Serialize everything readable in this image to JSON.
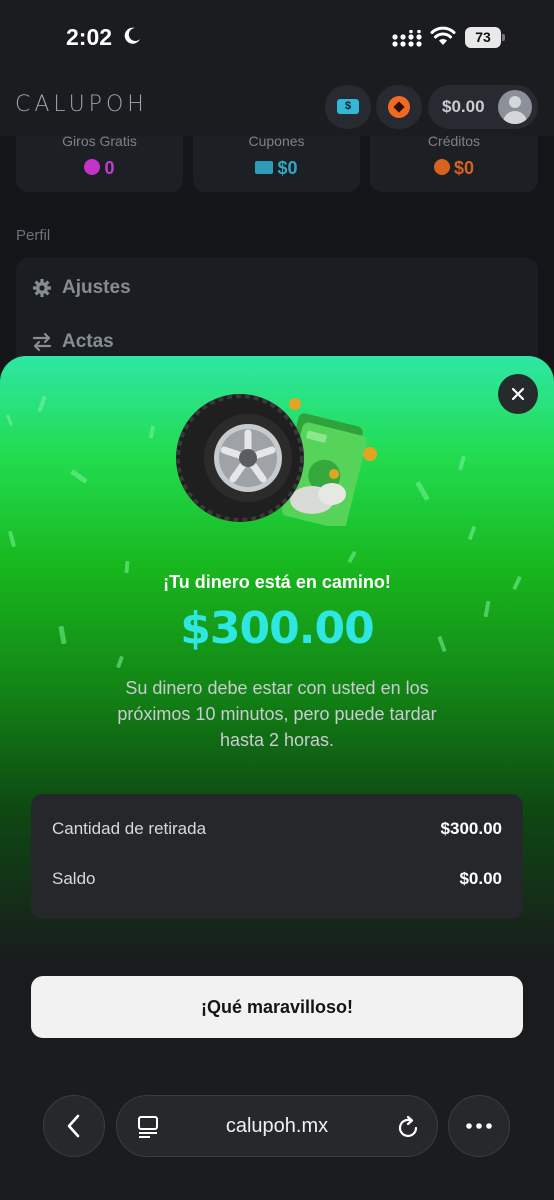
{
  "status_bar": {
    "time": "2:02",
    "battery": "73"
  },
  "header": {
    "logo": "CALUPOH",
    "coupon_icon_label": "$",
    "balance": "$0.00"
  },
  "stats": [
    {
      "label": "Giros Gratis",
      "value": "0",
      "icon": "gem-icon",
      "color": "#c03fcf"
    },
    {
      "label": "Cupones",
      "value": "$0",
      "icon": "coupon-icon",
      "color": "#2fa8c8"
    },
    {
      "label": "Créditos",
      "value": "$0",
      "icon": "credit-icon",
      "color": "#d9621e"
    }
  ],
  "profile": {
    "section_title": "Perfil",
    "items": [
      {
        "label": "Ajustes",
        "icon": "gear-icon"
      },
      {
        "label": "Actas",
        "icon": "transfer-arrows-icon"
      }
    ]
  },
  "modal": {
    "headline": "¡Tu dinero está en camino!",
    "amount": "$300.00",
    "description": "Su dinero debe estar con usted en los próximos 10 minutos, pero puede tardar hasta 2 horas.",
    "rows": [
      {
        "label": "Cantidad de retirada",
        "value": "$300.00"
      },
      {
        "label": "Saldo",
        "value": "$0.00"
      }
    ],
    "cta_label": "¡Qué maravilloso!",
    "accent_color": "#2ee6e2",
    "gradient_top": "#2ee7a4",
    "gradient_mid": "#22dc4f"
  },
  "browser": {
    "url": "calupoh.mx"
  }
}
